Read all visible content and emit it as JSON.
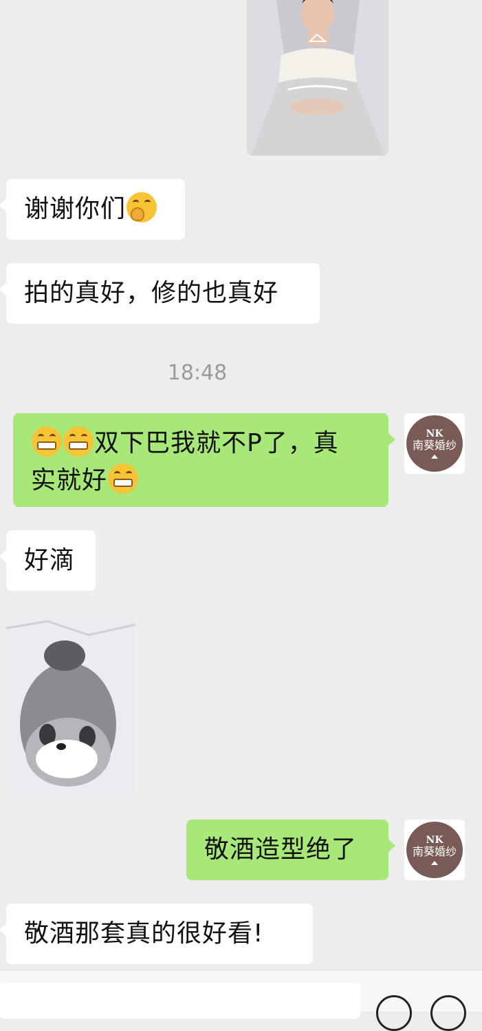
{
  "messages": {
    "m1": "谢谢你们",
    "m2": "拍的真好，修的也真好",
    "time": "18:48",
    "m3_text1": "双下巴我就不P了，真",
    "m3_text2": "实就好",
    "m4": "好滴",
    "m5": "敬酒造型绝了",
    "m6": "敬酒那套真的很好看!"
  },
  "avatar": {
    "logo_mark": "NK",
    "brand_name": "南葵婚纱"
  },
  "colors": {
    "background": "#ededed",
    "bubble_self": "#a8e878",
    "bubble_other": "#ffffff",
    "avatar_brand": "#7a5a56"
  },
  "icons": {
    "emoji_grin": "grinning-face-emoji",
    "emoji_hands": "face-with-hand-over-mouth-emoji",
    "voice": "voice-icon",
    "add": "plus-circle-icon"
  }
}
